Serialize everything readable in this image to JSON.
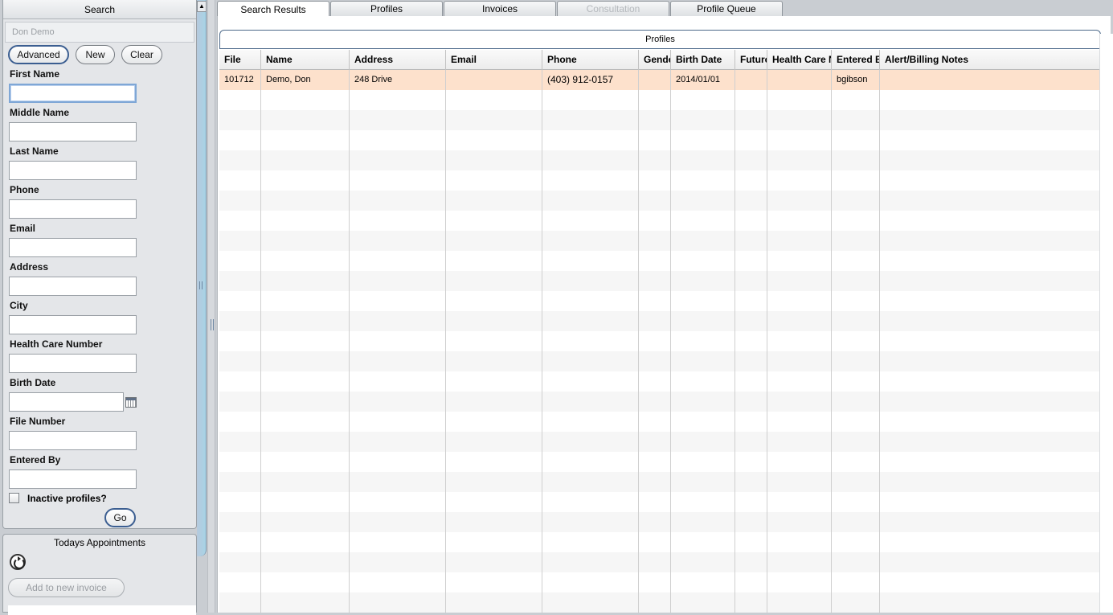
{
  "search_panel": {
    "title": "Search",
    "current_profile": "Don Demo",
    "buttons": {
      "advanced": "Advanced",
      "new": "New",
      "clear": "Clear"
    },
    "fields": {
      "first_name": "First Name",
      "middle_name": "Middle Name",
      "last_name": "Last Name",
      "phone": "Phone",
      "email": "Email",
      "address": "Address",
      "city": "City",
      "health_care_number": "Health Care Number",
      "birth_date": "Birth Date",
      "file_number": "File Number",
      "entered_by": "Entered By"
    },
    "inactive_label": "Inactive profiles?",
    "go_label": "Go"
  },
  "appointments": {
    "title": "Todays Appointments",
    "add_invoice_label": "Add to new invoice"
  },
  "tabs": [
    {
      "label": "Search Results",
      "state": "active"
    },
    {
      "label": "Profiles",
      "state": "normal"
    },
    {
      "label": "Invoices",
      "state": "normal"
    },
    {
      "label": "Consultation",
      "state": "disabled"
    },
    {
      "label": "Profile Queue",
      "state": "normal"
    }
  ],
  "results": {
    "header": "Profiles",
    "columns": [
      "File",
      "Name",
      "Address",
      "Email",
      "Phone",
      "Gender",
      "Birth Date",
      "Future",
      "Health Care N",
      "Entered By",
      "Alert/Billing Notes"
    ],
    "rows": [
      {
        "file": "101712",
        "name": "Demo, Don",
        "address": "248 Drive",
        "email": "",
        "phone": "(403) 912-0157",
        "gender": "",
        "birth_date": "2014/01/01",
        "future": "",
        "health_care": "",
        "entered_by": "bgibson",
        "notes": ""
      }
    ]
  },
  "colors": {
    "selected_row": "#fde1cc",
    "accent_border": "#3b5e91",
    "panel_bg": "#e4e6e9"
  }
}
